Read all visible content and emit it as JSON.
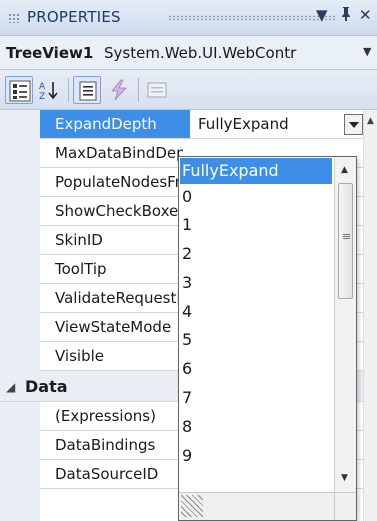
{
  "panel": {
    "title": "PROPERTIES",
    "pin_glyph": "▼ ",
    "pin_icon": "pin-icon",
    "close_icon": "close-icon"
  },
  "selector": {
    "object_name": "TreeView1",
    "object_type": "System.Web.UI.WebContr"
  },
  "toolbar": {
    "buttons": [
      {
        "icon": "categorized-icon",
        "active": true
      },
      {
        "icon": "alphabetical-icon",
        "active": false
      },
      {
        "icon": "properties-icon",
        "active": true
      },
      {
        "icon": "events-icon",
        "active": false
      },
      {
        "icon": "property-pages-icon",
        "active": false
      }
    ]
  },
  "grid": {
    "rows": [
      {
        "name": "ExpandDepth",
        "value": "FullyExpand"
      },
      {
        "name": "MaxDataBindDepth",
        "value": ""
      },
      {
        "name": "PopulateNodesFromClient",
        "value": ""
      },
      {
        "name": "ShowCheckBoxes",
        "value": ""
      },
      {
        "name": "SkinID",
        "value": ""
      },
      {
        "name": "ToolTip",
        "value": ""
      },
      {
        "name": "ValidateRequestMode",
        "value": ""
      },
      {
        "name": "ViewStateMode",
        "value": ""
      },
      {
        "name": "Visible",
        "value": ""
      }
    ],
    "category": "Data",
    "data_rows": [
      {
        "name": "(Expressions)"
      },
      {
        "name": "DataBindings"
      },
      {
        "name": "DataSourceID"
      }
    ]
  },
  "dropdown": {
    "options": [
      "FullyExpand",
      "0",
      "1",
      "2",
      "3",
      "4",
      "5",
      "6",
      "7",
      "8",
      "9"
    ],
    "selected": "FullyExpand"
  },
  "colors": {
    "selection": "#3d8ee6",
    "gutter": "#e9edf4",
    "title_text": "#1f3a68"
  }
}
